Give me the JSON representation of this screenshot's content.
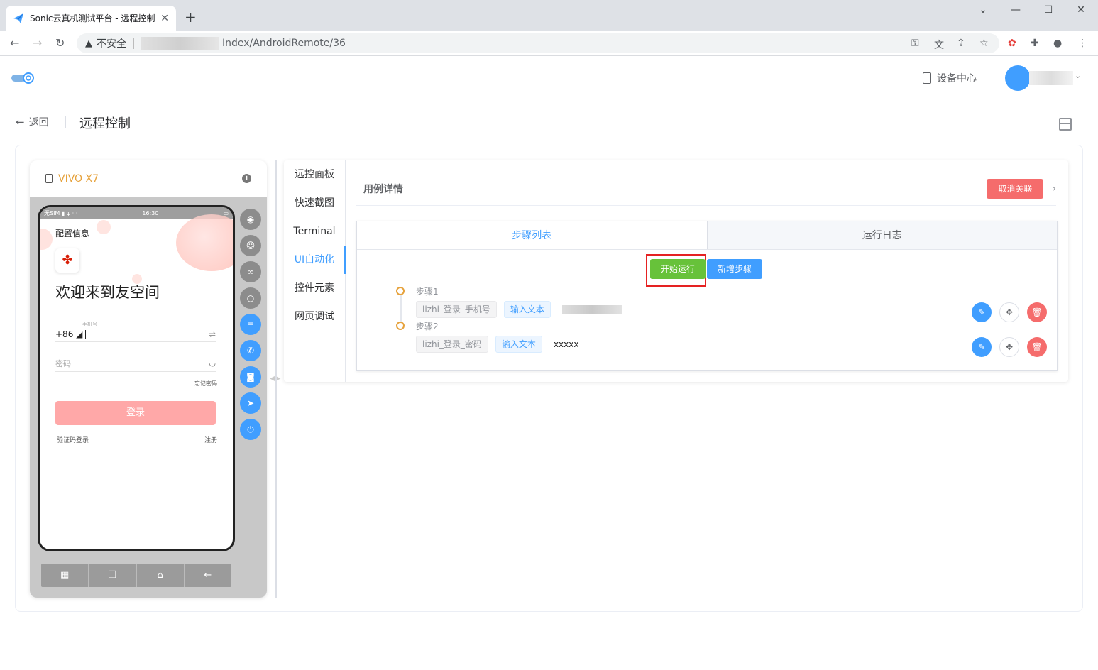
{
  "browser": {
    "tab_title": "Sonic云真机测试平台 - 远程控制",
    "tab_close": "✕",
    "new_tab": "+",
    "insecure_label": "不安全",
    "url_visible": "Index/AndroidRemote/36"
  },
  "header": {
    "device_center": "设备中心"
  },
  "page": {
    "back_label": "返回",
    "title": "远程控制"
  },
  "device": {
    "name": "VIVO X7",
    "screen": {
      "status_left": "无SIM ▮ ψ ···",
      "status_time": "16:30",
      "config_info": "配置信息",
      "welcome": "欢迎来到友空间",
      "phone_hint": "手机号",
      "country_code": "+86 ◢",
      "password_placeholder": "密码",
      "forgot_password": "忘记密码",
      "login_button": "登录",
      "sms_login": "验证码登录",
      "register": "注册"
    }
  },
  "tabs": [
    "远控面板",
    "快速截图",
    "Terminal",
    "UI自动化",
    "控件元素",
    "网页调试"
  ],
  "case": {
    "title": "用例详情",
    "unlink_button": "取消关联",
    "subtabs": [
      "步骤列表",
      "运行日志"
    ],
    "run_button": "开始运行",
    "add_step_button": "新增步骤",
    "steps": [
      {
        "title": "步骤1",
        "element": "lizhi_登录_手机号",
        "action": "输入文本",
        "value": ""
      },
      {
        "title": "步骤2",
        "element": "lizhi_登录_密码",
        "action": "输入文本",
        "value": "xxxxx"
      }
    ]
  },
  "colors": {
    "primary": "#409eff",
    "success": "#67c23a",
    "danger": "#f56c6c",
    "warning": "#e6a23c",
    "highlight": "#e52222"
  }
}
